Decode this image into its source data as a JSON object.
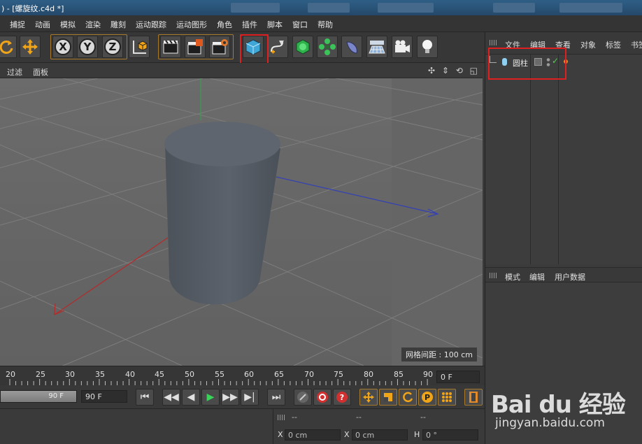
{
  "window": {
    "title": ") - [螺旋纹.c4d *]"
  },
  "menubar": {
    "items": [
      "捕捉",
      "动画",
      "模拟",
      "渲染",
      "雕刻",
      "运动跟踪",
      "运动图形",
      "角色",
      "插件",
      "脚本",
      "窗口",
      "帮助"
    ]
  },
  "toolbar": {
    "axis_labels": [
      "X",
      "Y",
      "Z"
    ],
    "icons": [
      "rotate-icon",
      "move-icon",
      "x-axis-icon",
      "y-axis-icon",
      "z-axis-icon",
      "coordinate-system-icon",
      "render-view-icon",
      "render-picture-queue-icon",
      "render-settings-icon",
      "cube-primitive-icon",
      "spline-pen-icon",
      "subdivision-surface-icon",
      "array-cloner-icon",
      "deformer-bend-icon",
      "floor-environment-icon",
      "camera-icon",
      "light-icon"
    ]
  },
  "viewport": {
    "menu": [
      "过滤",
      "面板"
    ],
    "grid_spacing": "网格间距 : 100 cm",
    "nav_icons": "✣ ⇕ ⟲ ◱"
  },
  "object_manager": {
    "tabs": [
      "文件",
      "编辑",
      "查看",
      "对象",
      "标签",
      "书签"
    ],
    "objects": [
      {
        "name": "圆柱",
        "check": "✓"
      }
    ]
  },
  "attributes": {
    "tabs": [
      "模式",
      "编辑",
      "用户数据"
    ]
  },
  "timeline": {
    "ticks": [
      "20",
      "25",
      "30",
      "35",
      "40",
      "45",
      "50",
      "55",
      "60",
      "65",
      "70",
      "75",
      "80",
      "85",
      "90"
    ],
    "current_frame": "0 F"
  },
  "transport": {
    "end_frame_slider": "90 F",
    "end_frame_field": "90 F",
    "buttons": [
      "⏮",
      "◀◀",
      "◀",
      "▶",
      "▶▶",
      "▶|",
      "⏭"
    ]
  },
  "coordinates": {
    "dashes": [
      "--",
      "--",
      "--"
    ],
    "labels": [
      "X",
      "X",
      "H"
    ],
    "values": [
      "0 cm",
      "0 cm",
      "0 °"
    ]
  },
  "watermark": {
    "logo": "Bai du 经验",
    "url": "jingyan.baidu.com"
  },
  "colors": {
    "accent_orange": "#f0a418",
    "highlight_red": "#e02020",
    "viewport_bg": "#6a6a6a",
    "cylinder": "#5a6068"
  }
}
